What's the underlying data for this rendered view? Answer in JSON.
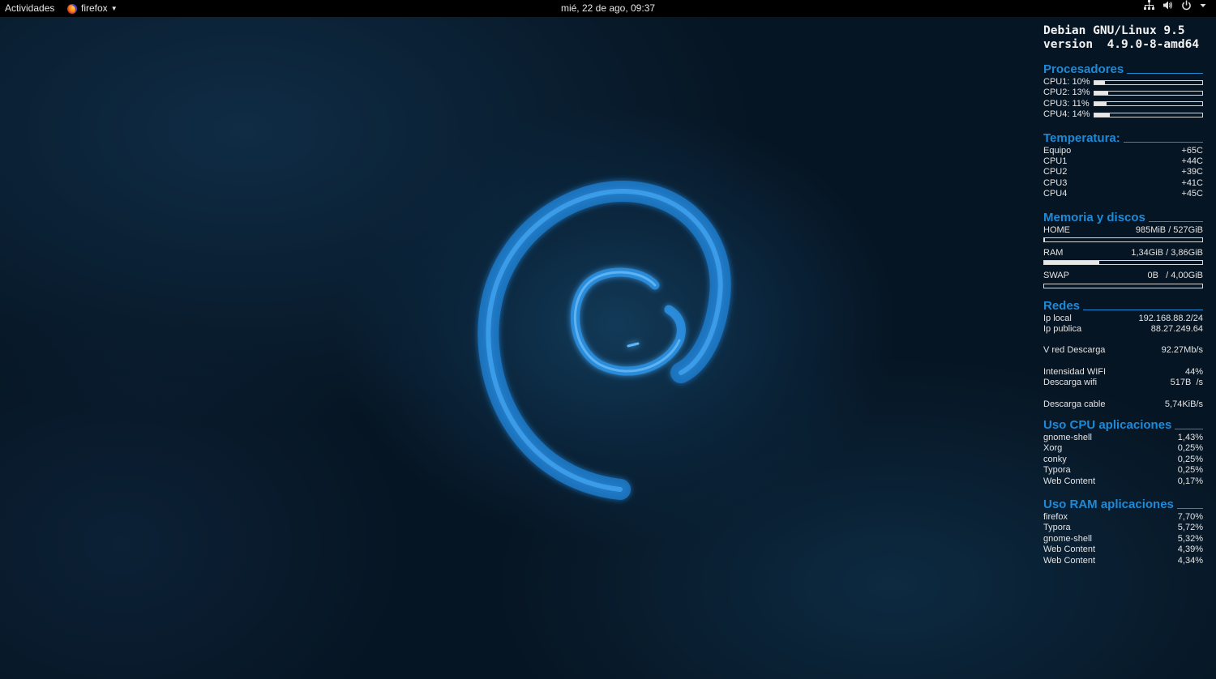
{
  "topbar": {
    "activities": "Actividades",
    "app_name": "firefox",
    "clock": "mié, 22 de ago, 09:37",
    "tray_icons": [
      "network-icon",
      "volume-icon",
      "power-icon",
      "caret-down-icon"
    ]
  },
  "colors": {
    "accent": "#1d8ad8",
    "panel_bg": "#000000",
    "text": "#e4e4e4"
  },
  "conky": {
    "system": {
      "line1": "Debian GNU/Linux 9.5",
      "line2": "version  4.9.0-8-amd64"
    },
    "processors": {
      "title": "Procesadores",
      "cpus": [
        {
          "label": "CPU1: 10%",
          "value": 0.1
        },
        {
          "label": "CPU2: 13%",
          "value": 0.13
        },
        {
          "label": "CPU3: 11%",
          "value": 0.11
        },
        {
          "label": "CPU4: 14%",
          "value": 0.14
        }
      ]
    },
    "temperature": {
      "title": "Temperatura:",
      "rows": [
        {
          "name": "Equipo",
          "value": "+65C"
        },
        {
          "name": "CPU1",
          "value": "+44C"
        },
        {
          "name": "CPU2",
          "value": "+39C"
        },
        {
          "name": "CPU3",
          "value": "+41C"
        },
        {
          "name": "CPU4",
          "value": "+45C"
        }
      ]
    },
    "memory": {
      "title": "Memoria y discos",
      "rows": [
        {
          "name": "HOME",
          "value": "985MiB / 527GiB",
          "usage": 0.002
        },
        {
          "name": "RAM",
          "value": "1,34GiB / 3,86GiB",
          "usage": 0.347
        },
        {
          "name": "SWAP",
          "value": "0B   / 4,00GiB",
          "usage": 0.0
        }
      ]
    },
    "networks": {
      "title": "Redes",
      "local_ip_label": "Ip local",
      "local_ip": "192.168.88.2/24",
      "public_ip_label": "Ip publica",
      "public_ip": "88.27.249.64",
      "download_label": "V red Descarga",
      "download": "92.27Mb/s",
      "wifi_strength_label": "Intensidad WIFI",
      "wifi_strength": "44%",
      "wifi_down_label": "Descarga wifi",
      "wifi_down": "517B  /s",
      "cable_down_label": "Descarga cable",
      "cable_down": "5,74KiB/s"
    },
    "cpu_apps": {
      "title": "Uso CPU aplicaciones",
      "rows": [
        {
          "name": "gnome-shell",
          "value": "1,43%"
        },
        {
          "name": "Xorg",
          "value": "0,25%"
        },
        {
          "name": "conky",
          "value": "0,25%"
        },
        {
          "name": "Typora",
          "value": "0,25%"
        },
        {
          "name": "Web Content",
          "value": "0,17%"
        }
      ]
    },
    "ram_apps": {
      "title": "Uso RAM aplicaciones",
      "rows": [
        {
          "name": "firefox",
          "value": "7,70%"
        },
        {
          "name": "Typora",
          "value": "5,72%"
        },
        {
          "name": "gnome-shell",
          "value": "5,32%"
        },
        {
          "name": "Web Content",
          "value": "4,39%"
        },
        {
          "name": "Web Content",
          "value": "4,34%"
        }
      ]
    }
  }
}
